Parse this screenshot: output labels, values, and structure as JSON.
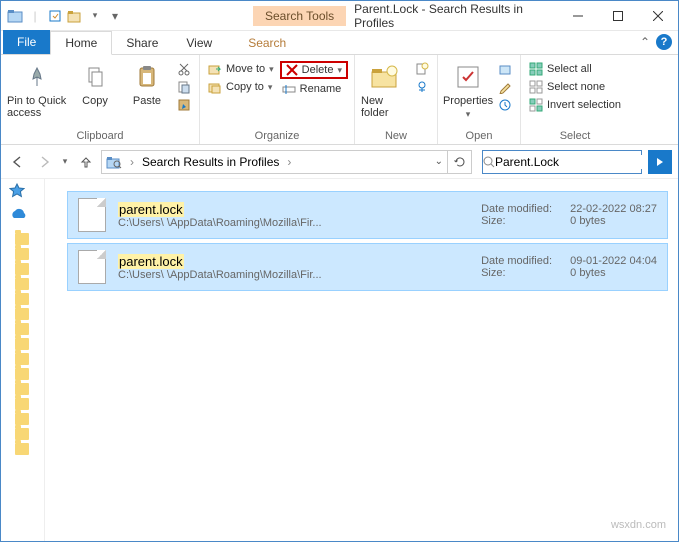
{
  "title": "Parent.Lock - Search Results in Profiles",
  "context_tab": "Search Tools",
  "tabs": {
    "file": "File",
    "home": "Home",
    "share": "Share",
    "view": "View",
    "search": "Search"
  },
  "ribbon": {
    "clipboard": {
      "pin": "Pin to Quick access",
      "copy": "Copy",
      "paste": "Paste",
      "label": "Clipboard"
    },
    "organize": {
      "move": "Move to",
      "copy": "Copy to",
      "delete": "Delete",
      "rename": "Rename",
      "label": "Organize"
    },
    "new": {
      "newfolder": "New folder",
      "label": "New"
    },
    "open": {
      "properties": "Properties",
      "label": "Open"
    },
    "select": {
      "all": "Select all",
      "none": "Select none",
      "invert": "Invert selection",
      "label": "Select"
    }
  },
  "address": {
    "crumb1": "Search Results in Profiles",
    "search_value": "Parent.Lock"
  },
  "results": [
    {
      "name": "parent.lock",
      "path": "C:\\Users\\            \\AppData\\Roaming\\Mozilla\\Fir...",
      "date_label": "Date modified:",
      "date": "22-02-2022 08:27",
      "size_label": "Size:",
      "size": "0 bytes"
    },
    {
      "name": "parent.lock",
      "path": "C:\\Users\\            \\AppData\\Roaming\\Mozilla\\Fir...",
      "date_label": "Date modified:",
      "date": "09-01-2022 04:04",
      "size_label": "Size:",
      "size": "0 bytes"
    }
  ],
  "watermark": "wsxdn.com"
}
